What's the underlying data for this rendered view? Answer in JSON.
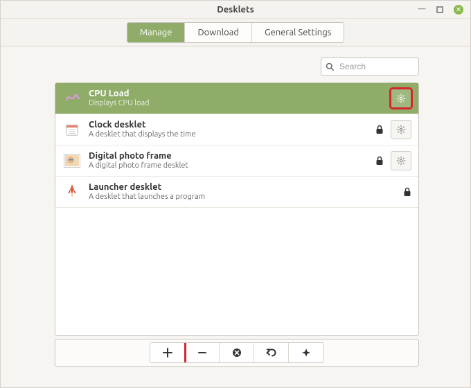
{
  "window": {
    "title": "Desklets"
  },
  "tabs": {
    "manage": "Manage",
    "download": "Download",
    "general": "General Settings",
    "active_index": 0
  },
  "search": {
    "placeholder": "Search",
    "value": ""
  },
  "desklets": [
    {
      "id": "cpu-load",
      "name": "CPU Load",
      "description": "Displays CPU load",
      "selected": true,
      "locked": false,
      "settings": true,
      "icon": "cpu"
    },
    {
      "id": "clock",
      "name": "Clock desklet",
      "description": "A desklet that displays the time",
      "selected": false,
      "locked": true,
      "settings": true,
      "icon": "calendar"
    },
    {
      "id": "photo",
      "name": "Digital photo frame",
      "description": "A digital photo frame desklet",
      "selected": false,
      "locked": true,
      "settings": true,
      "icon": "photo"
    },
    {
      "id": "launcher",
      "name": "Launcher desklet",
      "description": "A desklet that launches a program",
      "selected": false,
      "locked": true,
      "settings": false,
      "icon": "rocket"
    }
  ],
  "highlights": {
    "manage_tab": true,
    "selected_gear": true,
    "add_button": true
  },
  "toolbar": {
    "add": "add",
    "remove": "remove",
    "delete": "delete",
    "undo": "undo",
    "defaults": "defaults"
  },
  "colors": {
    "accent": "#8fac69",
    "highlight": "#d4262c"
  }
}
